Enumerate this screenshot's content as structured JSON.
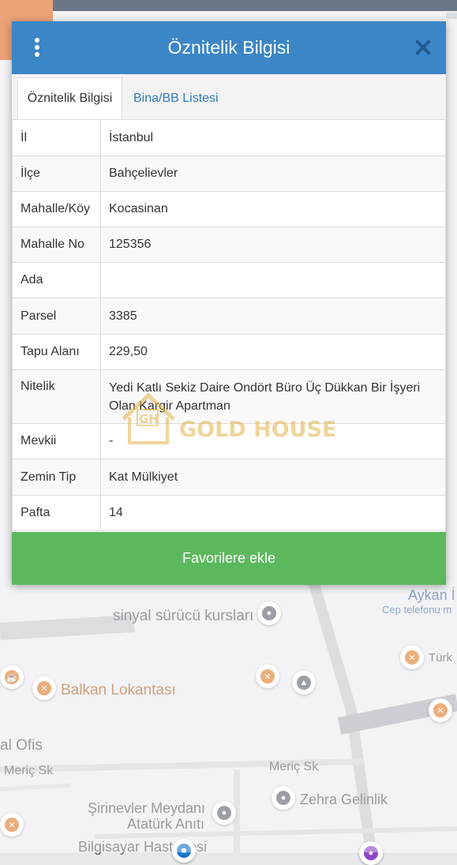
{
  "dialog": {
    "title": "Öznitelik Bilgisi",
    "tabs": [
      {
        "label": "Öznitelik Bilgisi",
        "active": true
      },
      {
        "label": "Bina/BB Listesi",
        "active": false
      }
    ],
    "rows": [
      {
        "key": "İl",
        "value": "İstanbul"
      },
      {
        "key": "İlçe",
        "value": "Bahçelievler"
      },
      {
        "key": "Mahalle/Köy",
        "value": "Kocasinan"
      },
      {
        "key": "Mahalle No",
        "value": "125356"
      },
      {
        "key": "Ada",
        "value": ""
      },
      {
        "key": "Parsel",
        "value": "3385"
      },
      {
        "key": "Tapu Alanı",
        "value": "229,50"
      },
      {
        "key": "Nitelik",
        "value": "Yedi Katlı Sekiz Daire Ondört Büro Üç Dükkan Bir İşyeri Olan Kargir Apartman"
      },
      {
        "key": "Mevkii",
        "value": "-"
      },
      {
        "key": "Zemin Tip",
        "value": "Kat Mülkiyet"
      },
      {
        "key": "Pafta",
        "value": "14"
      }
    ],
    "favorite_button": "Favorilere ekle"
  },
  "watermark": {
    "text": "GOLD HOUSE",
    "mark": "GH"
  },
  "map": {
    "labels": {
      "aykan": "Aykan İ",
      "cep": "Cep telefonu m",
      "sinyal": "sinyal sürücü kursları",
      "turk": "Türk",
      "balkan": "Balkan Lokantası",
      "ofis": "al Ofis",
      "meric_left": "Meriç Sk",
      "meric_right": "Meriç Sk",
      "zehra": "Zehra Gelinlik",
      "sirinevler": "Şirinevler Meydanı",
      "ataturk": "Atatürk Anıtı",
      "bilgisayar": "Bilgisayar Hastanesi"
    }
  },
  "colors": {
    "header": "#3b86c6",
    "button": "#5cb85c",
    "tab_link": "#337ab7",
    "watermark": "#e2b347"
  }
}
